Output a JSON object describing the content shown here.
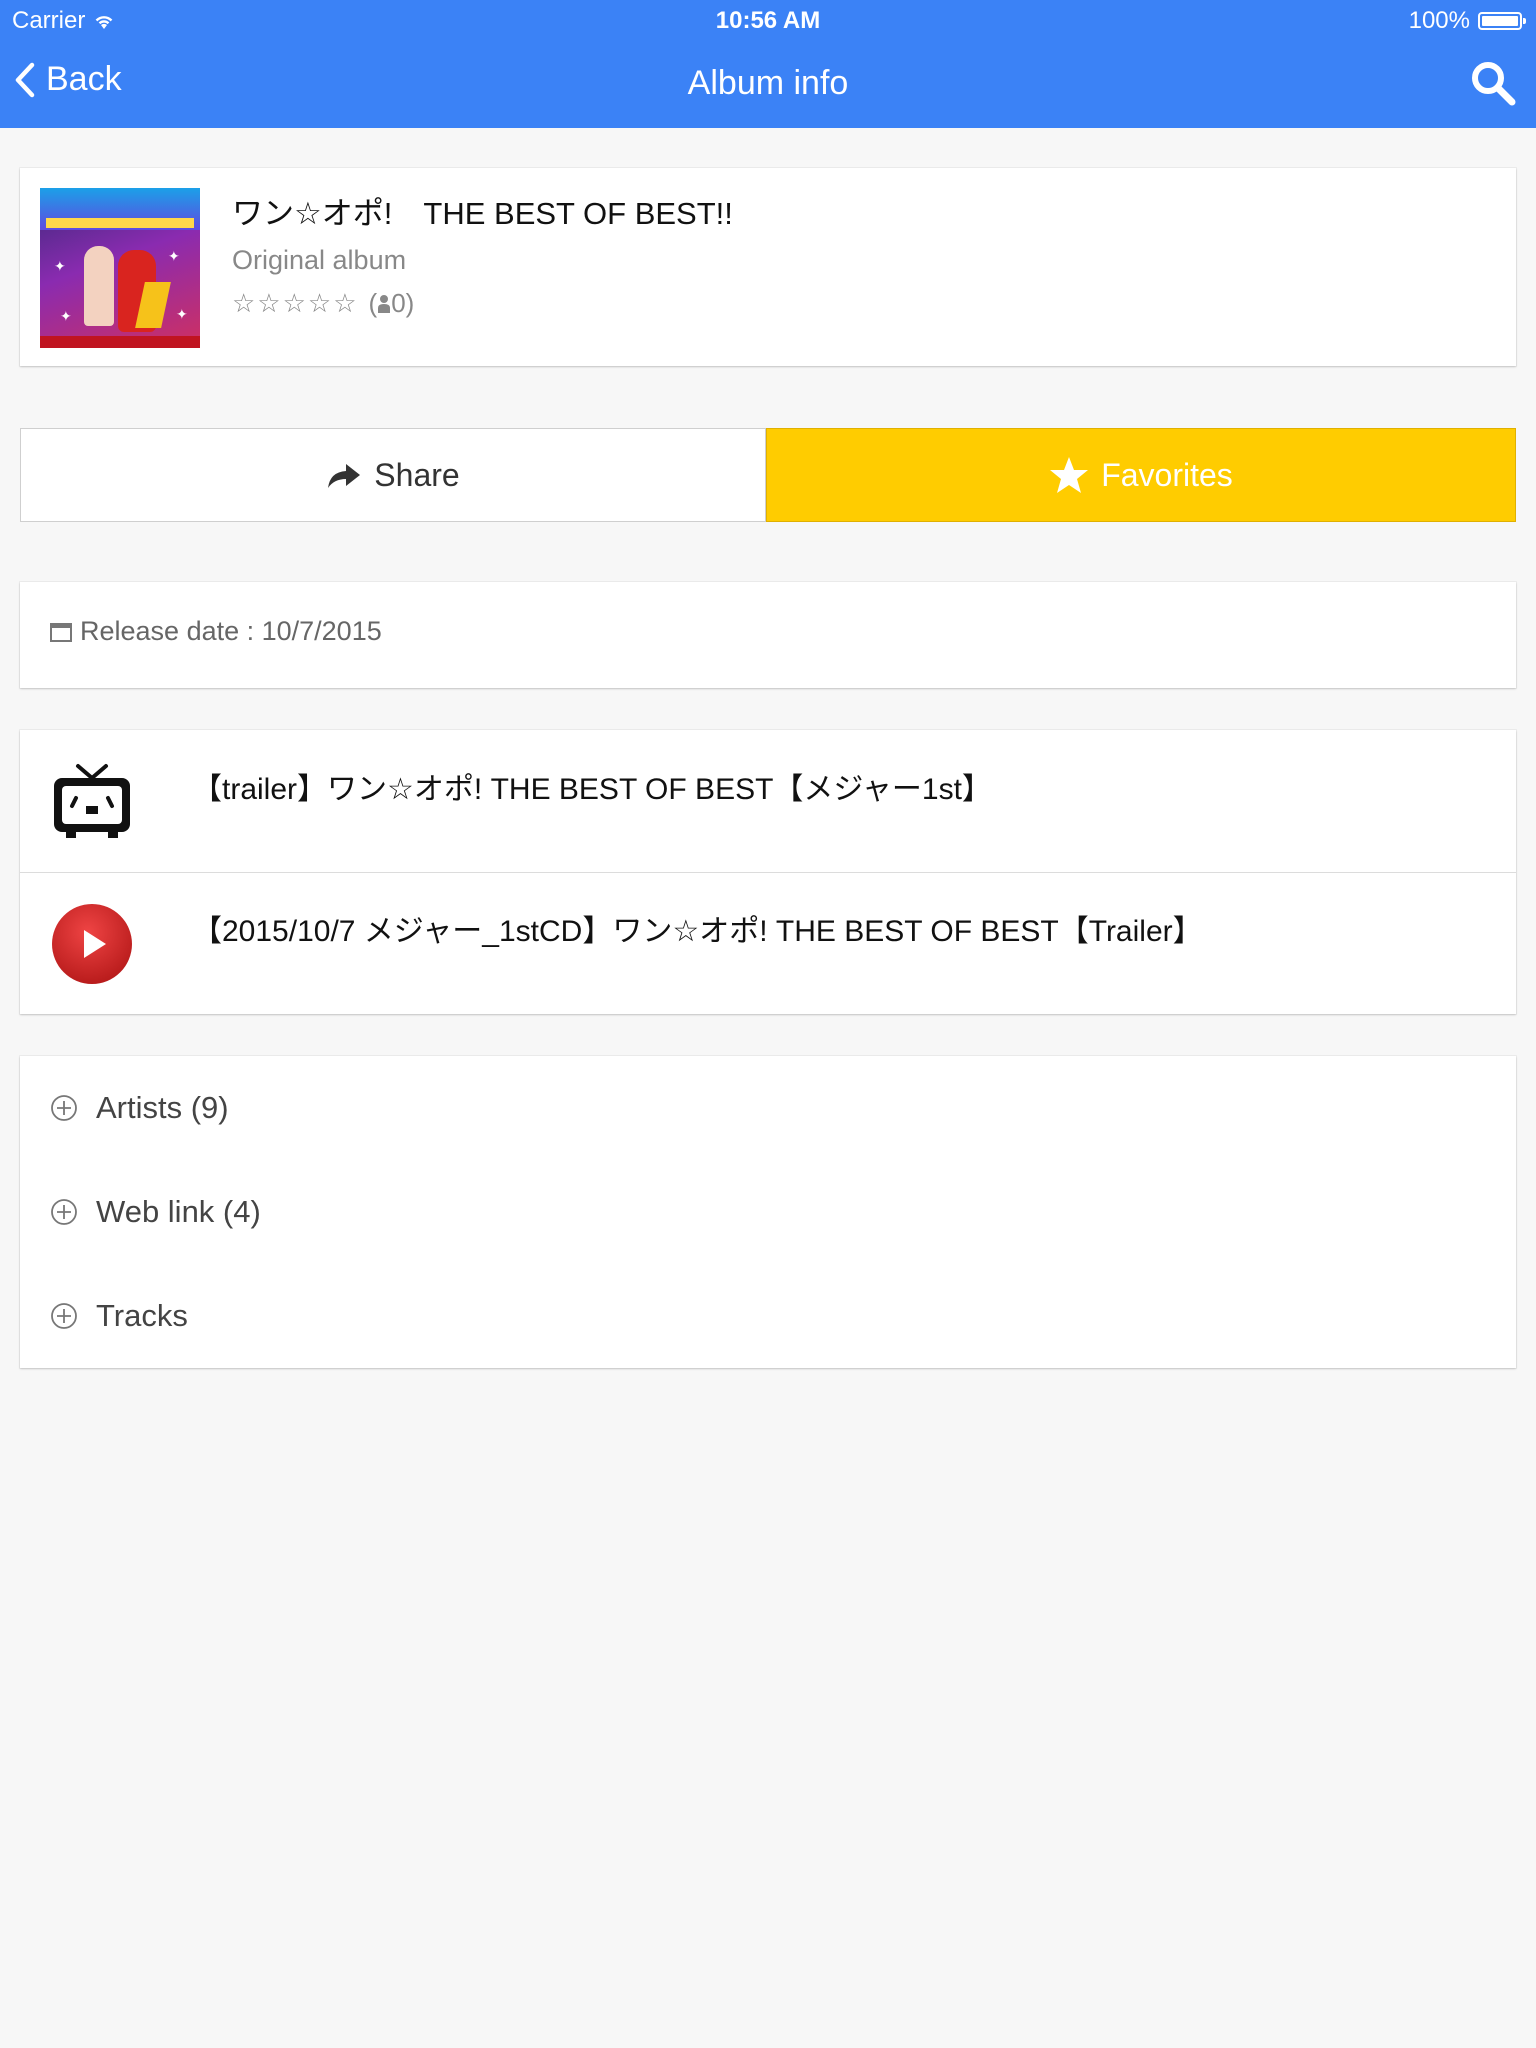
{
  "status_bar": {
    "carrier": "Carrier",
    "time": "10:56 AM",
    "battery": "100%"
  },
  "nav": {
    "back_label": "Back",
    "title": "Album info",
    "search_icon": "search-icon"
  },
  "album": {
    "title": "ワン☆オポ!　THE BEST OF BEST!!",
    "type": "Original album",
    "rating_stars": "☆☆☆☆☆",
    "rating_open": "(",
    "rating_count": "0)"
  },
  "actions": {
    "share_label": "Share",
    "favorites_label": "Favorites",
    "favorites_color": "#ffcc00"
  },
  "release": {
    "text": "Release date : 10/7/2015"
  },
  "videos": [
    {
      "icon": "niconico-tv-icon",
      "title": "【trailer】ワン☆オポ!  THE BEST OF BEST【メジャー1st】"
    },
    {
      "icon": "youtube-play-icon",
      "title": "【2015/10/7 メジャー_1stCD】ワン☆オポ!  THE BEST OF BEST【Trailer】"
    }
  ],
  "sections": [
    {
      "label": "Artists (9)"
    },
    {
      "label": "Web link (4)"
    },
    {
      "label": "Tracks"
    }
  ],
  "colors": {
    "header": "#3b82f6",
    "favorites": "#ffcc00",
    "background": "#f7f7f7",
    "youtube_red": "#d62828"
  }
}
